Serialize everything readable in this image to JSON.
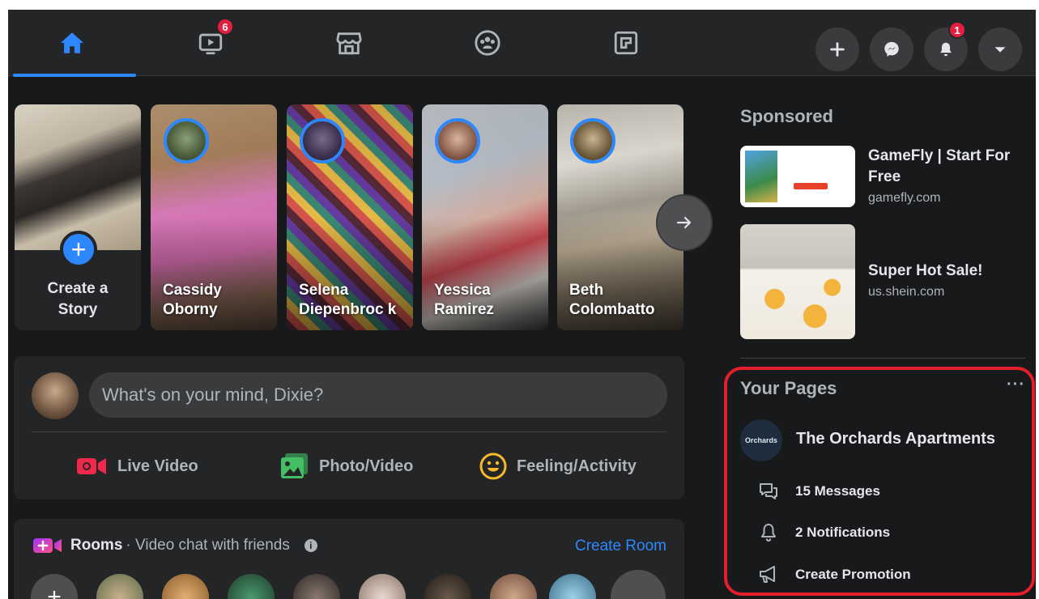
{
  "nav": {
    "tabs": [
      {
        "name": "home",
        "icon": "home-icon",
        "active": true
      },
      {
        "name": "watch",
        "icon": "watch-icon",
        "badge": "6"
      },
      {
        "name": "marketplace",
        "icon": "marketplace-icon"
      },
      {
        "name": "groups",
        "icon": "groups-icon"
      },
      {
        "name": "gaming",
        "icon": "gaming-icon"
      }
    ],
    "watch_badge": "6",
    "notifications_badge": "1",
    "actions": [
      "create-icon",
      "messenger-icon",
      "bell-icon",
      "caret-down-icon"
    ]
  },
  "stories": {
    "create": {
      "label_line1": "Create a",
      "label_line2": "Story"
    },
    "items": [
      {
        "name": "Cassidy Oborny"
      },
      {
        "name": "Selena Diepenbrock",
        "display": "Selena Diepenbroc k"
      },
      {
        "name": "Yessica Ramirez"
      },
      {
        "name": "Beth Colombatto"
      }
    ]
  },
  "composer": {
    "placeholder": "What's on your mind, Dixie?",
    "actions": {
      "live_video": "Live Video",
      "photo_video": "Photo/Video",
      "feeling": "Feeling/Activity"
    }
  },
  "rooms": {
    "title": "Rooms",
    "subtitle": " · Video chat with friends",
    "info": "i",
    "create_label": "Create Room"
  },
  "sponsored": {
    "heading": "Sponsored",
    "ads": [
      {
        "title_line1": "GameFly | Start For",
        "title_line2": "Free",
        "domain": "gamefly.com"
      },
      {
        "title_line1": "Super Hot Sale!",
        "domain": "us.shein.com"
      }
    ]
  },
  "your_pages": {
    "heading": "Your Pages",
    "more": "···",
    "page_name": "The Orchards Apartments",
    "avatar_text": "Orchards",
    "messages": "15 Messages",
    "notifications": "2 Notifications",
    "promotion": "Create Promotion"
  },
  "colors": {
    "accent": "#2d88ff",
    "badge": "#e41e3f",
    "highlight": "#e41e2b",
    "surface": "#242526",
    "background": "#18191a"
  }
}
